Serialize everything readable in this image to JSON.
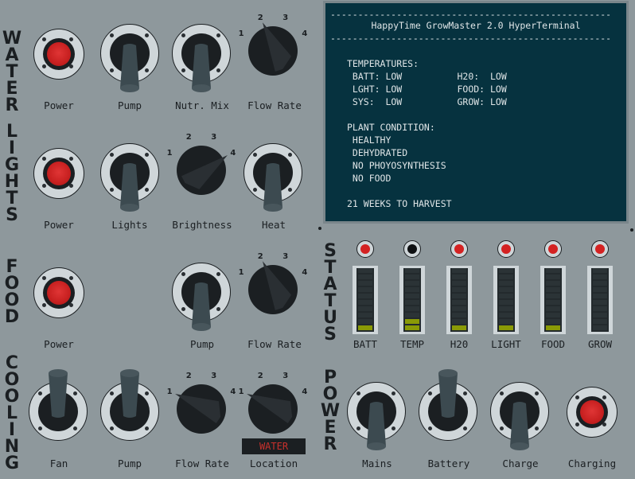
{
  "sections": {
    "water": "WATER",
    "lights": "LIGHTS",
    "food": "FOOD",
    "cooling": "COOLING",
    "status": "STATUS",
    "power": "POWER"
  },
  "water": {
    "power_label": "Power",
    "pump_label": "Pump",
    "pump_state": "down",
    "nutr_mix_label": "Nutr. Mix",
    "nutr_mix_state": "down",
    "flow_rate_label": "Flow Rate",
    "flow_rate_value": 2,
    "knob_ticks": [
      "1",
      "2",
      "3",
      "4"
    ]
  },
  "lights": {
    "power_label": "Power",
    "lights_label": "Lights",
    "lights_state": "down",
    "brightness_label": "Brightness",
    "brightness_value": 4,
    "heat_label": "Heat",
    "heat_state": "down",
    "knob_ticks": [
      "1",
      "2",
      "3",
      "4"
    ]
  },
  "food": {
    "power_label": "Power",
    "pump_label": "Pump",
    "pump_state": "down",
    "flow_rate_label": "Flow Rate",
    "flow_rate_value": 2,
    "knob_ticks": [
      "1",
      "2",
      "3",
      "4"
    ]
  },
  "cooling": {
    "fan_label": "Fan",
    "fan_state": "up",
    "pump_label": "Pump",
    "pump_state": "up",
    "flow_rate_label": "Flow Rate",
    "flow_rate_value": 1,
    "location_label": "Location",
    "location_value": 1,
    "location_display": "WATER",
    "knob_ticks": [
      "1",
      "2",
      "3",
      "4"
    ]
  },
  "terminal": {
    "title": "HappyTime GrowMaster 2.0 HyperTerminal",
    "divider": "---------------------------------------------------",
    "temperatures_heading": "TEMPERATURES:",
    "temperatures": [
      {
        "left": " BATT: LOW",
        "right": "H20:  LOW"
      },
      {
        "left": " LGHT: LOW",
        "right": "FOOD: LOW"
      },
      {
        "left": " SYS:  LOW",
        "right": "GROW: LOW"
      }
    ],
    "plant_heading": "PLANT CONDITION:",
    "plant_conditions": [
      " HEALTHY",
      " DEHYDRATED",
      " NO PHOYOSYNTHESIS",
      " NO FOOD"
    ],
    "harvest": "21 WEEKS TO HARVEST"
  },
  "status": {
    "segments": 10,
    "colors": {
      "led_on": "#d42222",
      "led_off": "#0e1012",
      "segment_on": "#8a9a06"
    },
    "meters": [
      {
        "label": "BATT",
        "led": "on",
        "level": 1
      },
      {
        "label": "TEMP",
        "led": "off",
        "level": 2
      },
      {
        "label": "H20",
        "led": "on",
        "level": 1
      },
      {
        "label": "LIGHT",
        "led": "on",
        "level": 1
      },
      {
        "label": "FOOD",
        "led": "on",
        "level": 1
      },
      {
        "label": "GROW",
        "led": "on",
        "level": 0
      }
    ]
  },
  "power": {
    "mains_label": "Mains",
    "mains_state": "down",
    "battery_label": "Battery",
    "battery_state": "up",
    "charge_label": "Charge",
    "charge_state": "down",
    "charging_label": "Charging"
  }
}
